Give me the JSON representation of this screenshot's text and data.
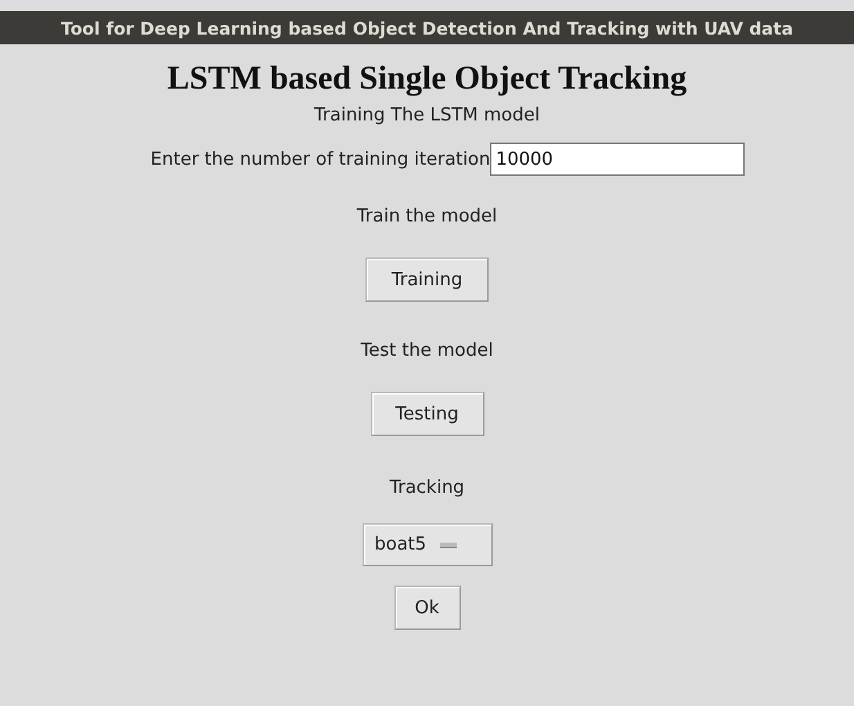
{
  "window": {
    "title": "Tool for Deep Learning based Object Detection And Tracking with UAV data"
  },
  "heading": "LSTM based Single Object Tracking",
  "subtitle": "Training The LSTM model",
  "iterations": {
    "label": "Enter the number of training iteration",
    "value": "10000"
  },
  "train": {
    "label": "Train the model",
    "button": "Training"
  },
  "test": {
    "label": "Test the model",
    "button": "Testing"
  },
  "tracking": {
    "label": "Tracking",
    "value": "boat5"
  },
  "ok_button": "Ok"
}
